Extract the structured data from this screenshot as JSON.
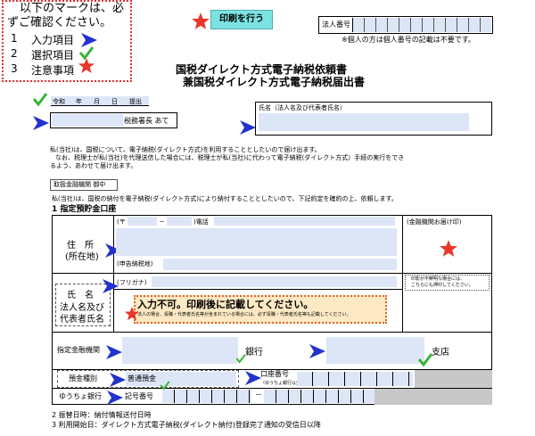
{
  "legend": {
    "line1": "以下のマークは、必",
    "line2": "ずご確認ください。",
    "items": [
      {
        "num": "1",
        "label": "入力項目"
      },
      {
        "num": "2",
        "label": "選択項目"
      },
      {
        "num": "3",
        "label": "注意事項"
      }
    ]
  },
  "print_button": "印刷を行う",
  "corp_number": {
    "label": "法人番号",
    "note": "※個人の方は個人番号の記載は不要です。"
  },
  "title": {
    "line1": "国税ダイレクト方式電子納税依頼書",
    "line2": "兼国税ダイレクト方式電子納税届出書"
  },
  "date": {
    "era": "令和",
    "year": "年",
    "month": "月",
    "day": "日",
    "submit": "提出"
  },
  "tax_office": {
    "suffix": "税務署長 あて"
  },
  "name_box": {
    "label": "氏名（法人名及び代表者氏名）"
  },
  "intro": {
    "p1": "私(当社)は、国税について、電子納税(ダイレクト方式)を利用することとしたいので届け出ます。",
    "p2a": "なお、税理士が私(当社)を代理送信した場合には、税理士が私(当社)に代わって電子納税(ダイレクト方式）手続の実行をでき",
    "p2b": "るよう、あわせて届け出ます。"
  },
  "bank_addressee": "取扱金融機関 御中",
  "request": "私(当社)は、国税の納付を電子納税(ダイレクト方式)により納付することとしたいので、下記約定を確約の上、依頼します。",
  "section1": "1 指定預貯金口座",
  "address": {
    "label1": "住　所",
    "label2": "(所在地)",
    "postal_mark": "(〒",
    "dash": "－",
    "tel": ")電話",
    "tax_address": "(申告納税地)"
  },
  "seal": {
    "label": "(金融機関お届け印)"
  },
  "name_section": {
    "label1": "氏　名",
    "label2": "法人名及び",
    "label3": "代表者氏名",
    "furigana": "(フリガナ)",
    "seal_note1": "印影が不鮮明な場合には、",
    "seal_note2": "こちらにも押印してください。"
  },
  "notice": {
    "main": "入力不可。印刷後に記載してください。",
    "sub": "法人の場合、役職・代表者氏名等が含まれている場合には、必ず役職・代表者氏名等も記載してください。"
  },
  "bank": {
    "label": "指定金融機関",
    "bank_suffix": "銀行",
    "branch_suffix": "支店"
  },
  "deposit": {
    "label": "預金種別",
    "value": "普通預金",
    "account_label": "口座番号",
    "account_sub": "（ゆうちょ銀行以外）"
  },
  "yucho": {
    "label": "ゆうちょ銀行",
    "code_label": "記号番号",
    "dash": "－"
  },
  "footer": {
    "item2": "2 振替日時：納付情報送付日時",
    "item3": "3 利用開始日：ダイレクト方式電子納税(ダイレクト納付)登録完了通知の受信日以降"
  },
  "colors": {
    "input_fill": "#dde6f7",
    "button_fill": "#7ce3e3",
    "arrow": "#2233cc",
    "star": "#e8362a",
    "check": "#36b536",
    "legend_border": "#e03030",
    "notice_fill": "#fde9c4",
    "grey_fill": "#c8c8c8"
  }
}
